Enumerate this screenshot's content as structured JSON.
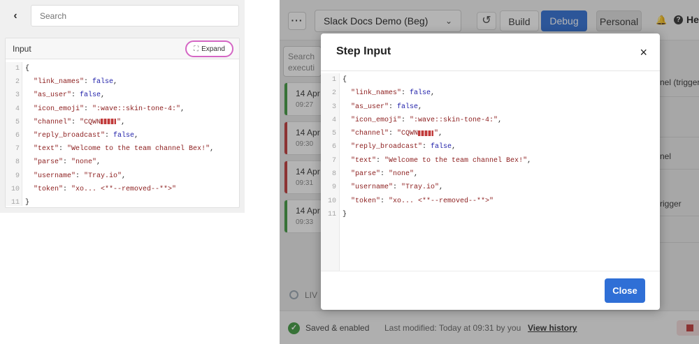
{
  "left_panel": {
    "search_placeholder": "Search",
    "input_title": "Input",
    "expand_label": "Expand",
    "code_lines": [
      {
        "n": "1",
        "parts": [
          {
            "t": "{",
            "c": "punct"
          }
        ]
      },
      {
        "n": "2",
        "parts": [
          {
            "t": "  \"link_names\"",
            "c": "key"
          },
          {
            "t": ": ",
            "c": "punct"
          },
          {
            "t": "false",
            "c": "kw"
          },
          {
            "t": ",",
            "c": "punct"
          }
        ]
      },
      {
        "n": "3",
        "parts": [
          {
            "t": "  \"as_user\"",
            "c": "key"
          },
          {
            "t": ": ",
            "c": "punct"
          },
          {
            "t": "false",
            "c": "kw"
          },
          {
            "t": ",",
            "c": "punct"
          }
        ]
      },
      {
        "n": "4",
        "parts": [
          {
            "t": "  \"icon_emoji\"",
            "c": "key"
          },
          {
            "t": ": ",
            "c": "punct"
          },
          {
            "t": "\":wave::skin-tone-4:\"",
            "c": "str"
          },
          {
            "t": ",",
            "c": "punct"
          }
        ]
      },
      {
        "n": "5",
        "parts": [
          {
            "t": "  \"channel\"",
            "c": "key"
          },
          {
            "t": ": ",
            "c": "punct"
          },
          {
            "t": "\"CQWN",
            "c": "str"
          },
          {
            "t": "",
            "c": "redact"
          },
          {
            "t": "\"",
            "c": "str"
          },
          {
            "t": ",",
            "c": "punct"
          }
        ]
      },
      {
        "n": "6",
        "parts": [
          {
            "t": "  \"reply_broadcast\"",
            "c": "key"
          },
          {
            "t": ": ",
            "c": "punct"
          },
          {
            "t": "false",
            "c": "kw"
          },
          {
            "t": ",",
            "c": "punct"
          }
        ]
      },
      {
        "n": "7",
        "parts": [
          {
            "t": "  \"text\"",
            "c": "key"
          },
          {
            "t": ": ",
            "c": "punct"
          },
          {
            "t": "\"Welcome to the team channel Bex!\"",
            "c": "str"
          },
          {
            "t": ",",
            "c": "punct"
          }
        ]
      },
      {
        "n": "8",
        "parts": [
          {
            "t": "  \"parse\"",
            "c": "key"
          },
          {
            "t": ": ",
            "c": "punct"
          },
          {
            "t": "\"none\"",
            "c": "str"
          },
          {
            "t": ",",
            "c": "punct"
          }
        ]
      },
      {
        "n": "9",
        "parts": [
          {
            "t": "  \"username\"",
            "c": "key"
          },
          {
            "t": ": ",
            "c": "punct"
          },
          {
            "t": "\"Tray.io\"",
            "c": "str"
          },
          {
            "t": ",",
            "c": "punct"
          }
        ]
      },
      {
        "n": "10",
        "parts": [
          {
            "t": "  \"token\"",
            "c": "key"
          },
          {
            "t": ": ",
            "c": "punct"
          },
          {
            "t": "\"xo... <**--removed--**>\"",
            "c": "str"
          }
        ]
      },
      {
        "n": "11",
        "parts": [
          {
            "t": "}",
            "c": "punct"
          }
        ]
      }
    ]
  },
  "app": {
    "menu_label": "···",
    "project_name": "Slack Docs Demo (Beg)",
    "undo_icon": "undo-icon",
    "build_label": "Build",
    "debug_label": "Debug",
    "personal_label": "Personal",
    "help_label": "Hel",
    "exec_search_text": "Search executi",
    "executions": [
      {
        "date": "14 Apr",
        "time": "09:27",
        "status_color": "#3f9a3f"
      },
      {
        "date": "14 Apr",
        "time": "09:30",
        "status_color": "#c23a3a"
      },
      {
        "date": "14 Apr",
        "time": "09:31",
        "status_color": "#c23a3a"
      },
      {
        "date": "14 Apr",
        "time": "09:33",
        "status_color": "#3f9a3f"
      }
    ],
    "live_label": "LIV",
    "right_strip": [
      "nel (trigger)",
      "nel",
      "rigger"
    ],
    "saved_label": "Saved & enabled",
    "modified_label": "Last modified: Today at 09:31 by you",
    "history_link": "View history"
  },
  "modal": {
    "title": "Step Input",
    "close_icon": "×",
    "close_button_label": "Close"
  },
  "colors": {
    "accent": "#2f6fd6",
    "success": "#3f9a3f",
    "error": "#c23a3a",
    "highlight_ring": "#d466c4"
  }
}
